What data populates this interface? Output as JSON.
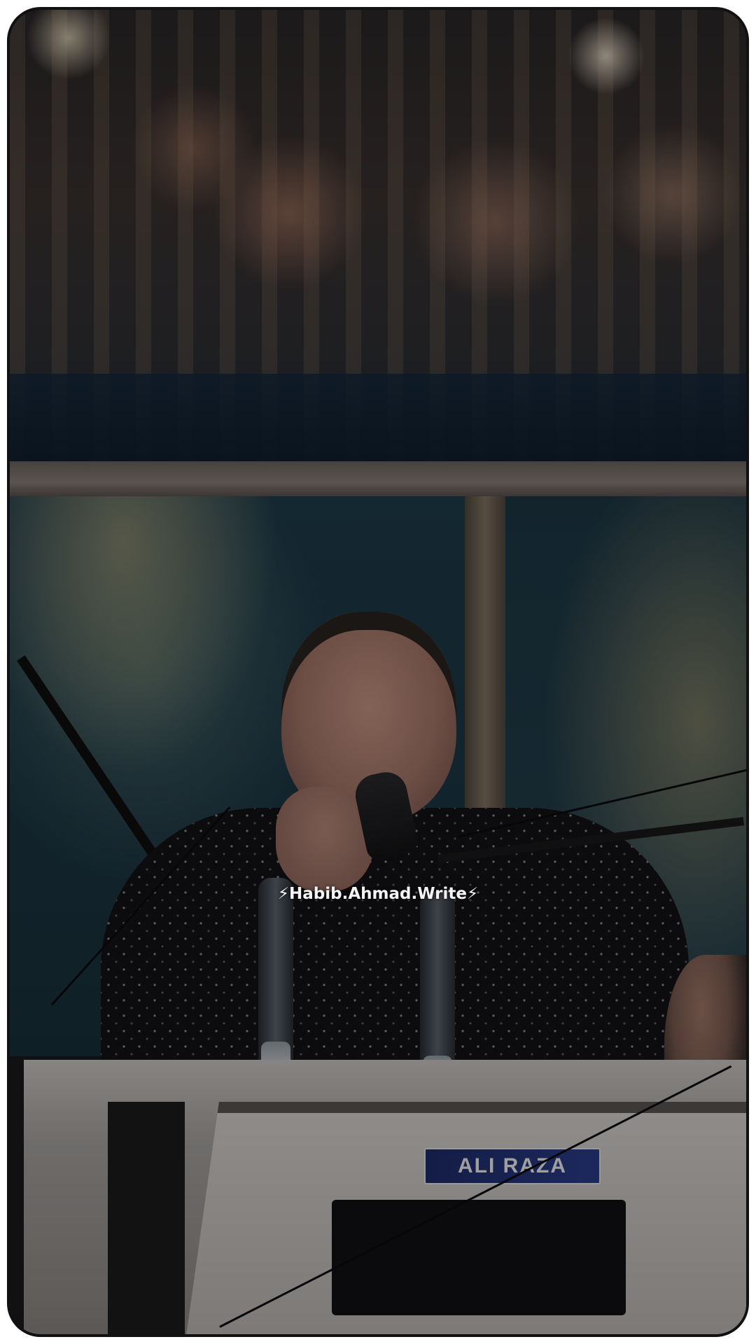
{
  "video": {
    "watermark_text": "⚡Habib.Ahmad.Write⚡",
    "brand_plate_text": "ALI RAZA"
  },
  "colors": {
    "frame_border": "#111111",
    "page_background": "#ffffff",
    "watermark_text": "#f4f4f4"
  }
}
